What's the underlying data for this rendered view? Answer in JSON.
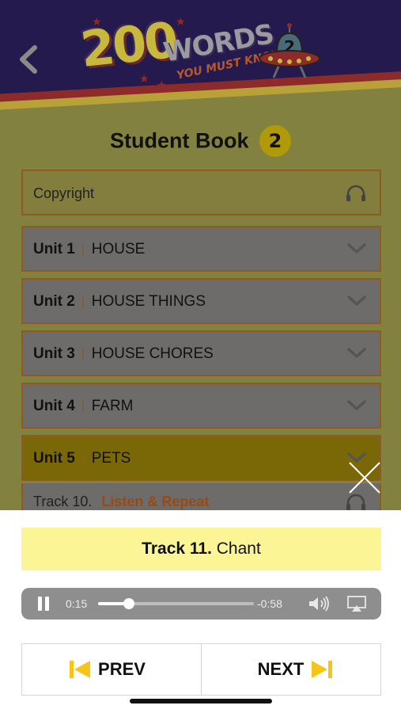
{
  "header": {
    "back_icon": "chevron-left-icon",
    "logo": {
      "number": "200",
      "words": "WORDS",
      "subtitle": "YOU MUST KNOW!",
      "badge": "2"
    }
  },
  "book": {
    "title": "Student Book",
    "number": "2"
  },
  "list": {
    "copyright": {
      "label": "Copyright",
      "icon": "headphones-icon"
    },
    "units": [
      {
        "unit": "Unit 1",
        "name": "HOUSE",
        "expanded": false
      },
      {
        "unit": "Unit 2",
        "name": "HOUSE THINGS",
        "expanded": false
      },
      {
        "unit": "Unit 3",
        "name": "HOUSE CHORES",
        "expanded": false
      },
      {
        "unit": "Unit 4",
        "name": "FARM",
        "expanded": false
      },
      {
        "unit": "Unit 5",
        "name": "PETS",
        "expanded": true
      }
    ],
    "visible_track": {
      "label": "Track 10.",
      "title": "Listen & Repeat"
    }
  },
  "player": {
    "now_playing": {
      "track": "Track 11.",
      "title": "Chant"
    },
    "current_time": "0:15",
    "remaining_time": "-0:58",
    "progress_fraction": 0.2,
    "state": "playing"
  },
  "nav": {
    "prev": "PREV",
    "next": "NEXT"
  },
  "colors": {
    "accent_yellow": "#f5c518",
    "now_playing_bg": "#fbf596"
  }
}
